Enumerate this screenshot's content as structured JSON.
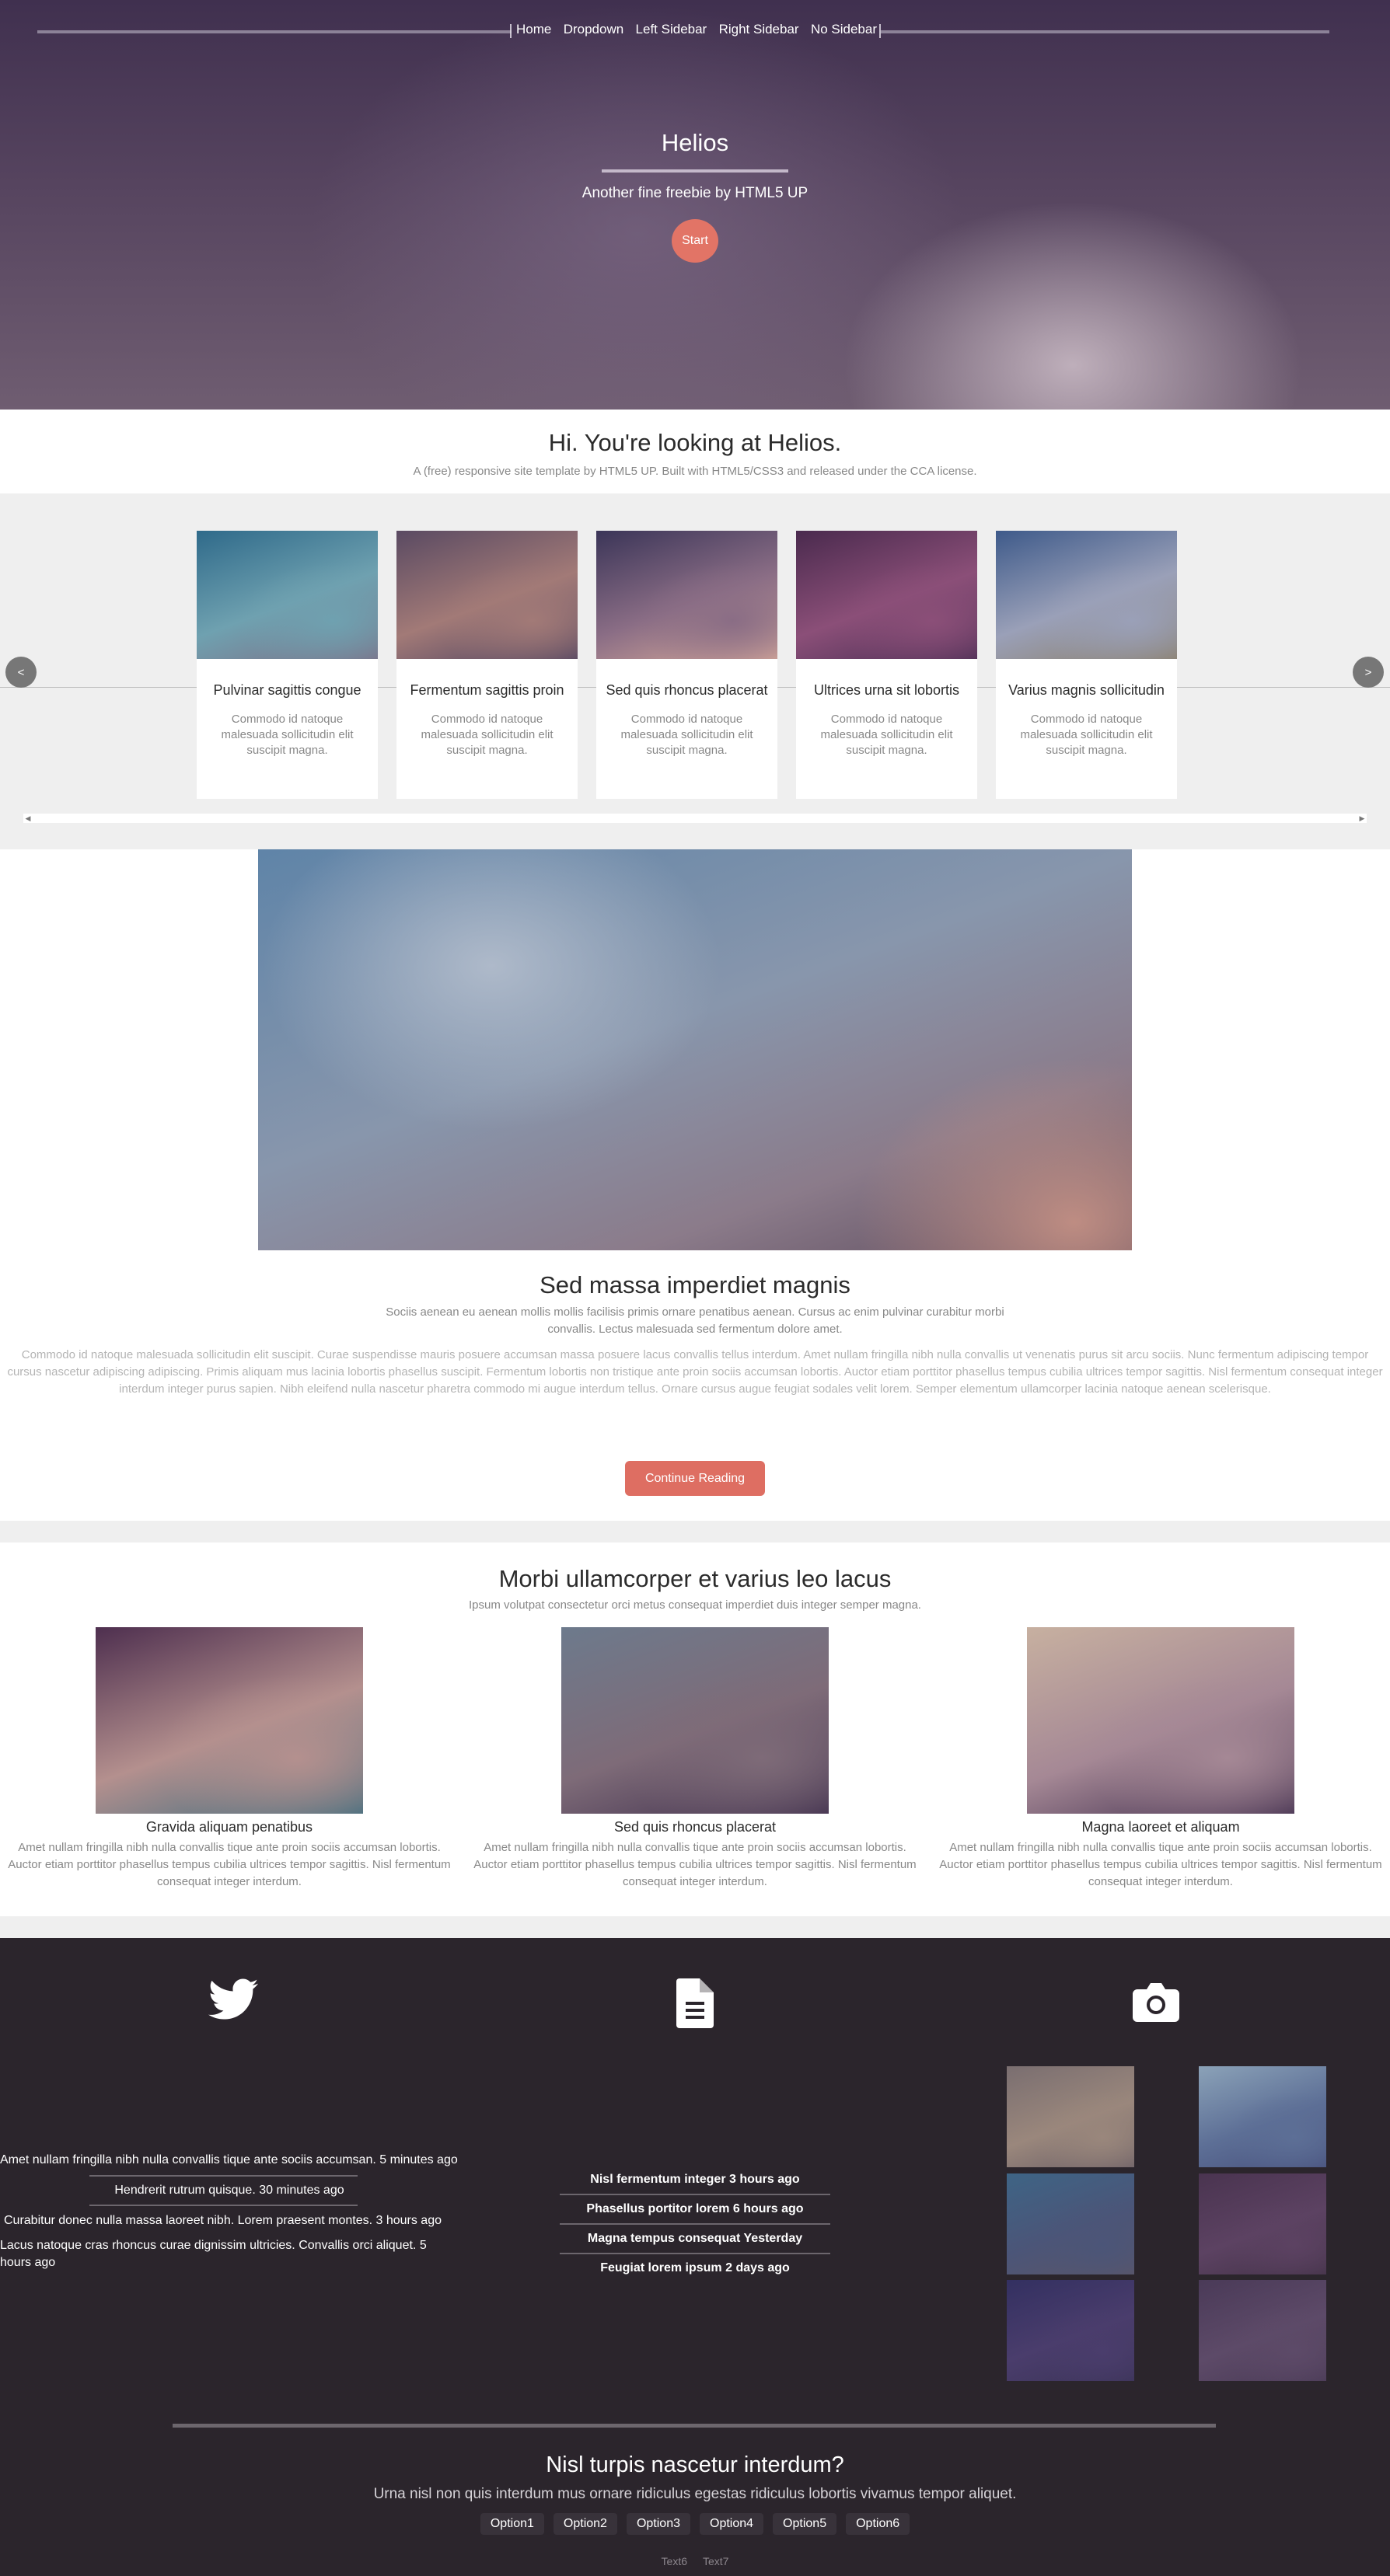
{
  "nav": {
    "items": [
      "Home",
      "Dropdown",
      "Left Sidebar",
      "Right Sidebar",
      "No Sidebar"
    ]
  },
  "hero": {
    "title": "Helios",
    "subtitle": "Another fine freebie by HTML5 UP",
    "button": "Start"
  },
  "intro": {
    "title": "Hi. You're looking at Helios.",
    "subtitle": "A (free) responsive site template by HTML5 UP. Built with HTML5/CSS3 and released under the CCA license."
  },
  "carousel": {
    "prev_icon": "chevron-left-icon",
    "prev_label": "<",
    "next_icon": "chevron-right-icon",
    "next_label": ">",
    "scroll_left": "◀",
    "scroll_right": "▶",
    "cards": [
      {
        "title": "Pulvinar sagittis congue",
        "desc": "Commodo id natoque malesuada sollicitudin elit suscipit magna.",
        "colors": [
          "#2f6a8a",
          "#6fa1b0",
          "#7d6f86"
        ]
      },
      {
        "title": "Fermentum sagittis proin",
        "desc": "Commodo id natoque malesuada sollicitudin elit suscipit magna.",
        "colors": [
          "#5a4a62",
          "#a27a77",
          "#4f4360"
        ]
      },
      {
        "title": "Sed quis rhoncus placerat",
        "desc": "Commodo id natoque malesuada sollicitudin elit suscipit magna.",
        "colors": [
          "#3b3558",
          "#8a6d85",
          "#d6a99a"
        ]
      },
      {
        "title": "Ultrices urna sit lobortis",
        "desc": "Commodo id natoque malesuada sollicitudin elit suscipit magna.",
        "colors": [
          "#4a2a4e",
          "#8b4f78",
          "#4a2e54"
        ]
      },
      {
        "title": "Varius magnis sollicitudin",
        "desc": "Commodo id natoque malesuada sollicitudin elit suscipit magna.",
        "colors": [
          "#3e5a8a",
          "#9aa0b8",
          "#8b7f6a"
        ]
      }
    ]
  },
  "article": {
    "title": "Sed massa imperdiet magnis",
    "lead": "Sociis aenean eu aenean mollis mollis facilisis primis ornare penatibus aenean. Cursus ac enim pulvinar curabitur morbi convallis. Lectus malesuada sed fermentum dolore amet.",
    "body": "Commodo id natoque malesuada sollicitudin elit suscipit. Curae suspendisse mauris posuere accumsan massa posuere lacus convallis tellus interdum. Amet nullam fringilla nibh nulla convallis ut venenatis purus sit arcu sociis. Nunc fermentum adipiscing tempor cursus nascetur adipiscing adipiscing. Primis aliquam mus lacinia lobortis phasellus suscipit. Fermentum lobortis non tristique ante proin sociis accumsan lobortis. Auctor etiam porttitor phasellus tempus cubilia ultrices tempor sagittis. Nisl fermentum consequat integer interdum integer purus sapien. Nibh eleifend nulla nascetur pharetra commodo mi augue interdum tellus. Ornare cursus augue feugiat sodales velit lorem. Semper elementum ullamcorper lacinia natoque aenean scelerisque.",
    "button": "Continue Reading"
  },
  "features": {
    "title": "Morbi ullamcorper et varius leo lacus",
    "subtitle": "Ipsum volutpat consectetur orci metus consequat imperdiet duis integer semper magna.",
    "items": [
      {
        "title": "Gravida aliquam penatibus",
        "desc": "Amet nullam fringilla nibh nulla convallis tique ante proin sociis accumsan lobortis. Auctor etiam porttitor phasellus tempus cubilia ultrices tempor sagittis. Nisl fermentum consequat integer interdum.",
        "colors": [
          "#4e2f4f",
          "#b4908e",
          "#3c6c7e"
        ]
      },
      {
        "title": "Sed quis rhoncus placerat",
        "desc": "Amet nullam fringilla nibh nulla convallis tique ante proin sociis accumsan lobortis. Auctor etiam porttitor phasellus tempus cubilia ultrices tempor sagittis. Nisl fermentum consequat integer interdum.",
        "colors": [
          "#6d7a8c",
          "#7e6b78",
          "#3e2e4c"
        ]
      },
      {
        "title": "Magna laoreet et aliquam",
        "desc": "Amet nullam fringilla nibh nulla convallis tique ante proin sociis accumsan lobortis. Auctor etiam porttitor phasellus tempus cubilia ultrices tempor sagittis. Nisl fermentum consequat integer interdum.",
        "colors": [
          "#c7b0a0",
          "#a58895",
          "#3e2c4c"
        ]
      }
    ]
  },
  "footer": {
    "twitter_icon": "twitter-icon",
    "document_icon": "document-icon",
    "camera_icon": "camera-icon",
    "tweets": [
      "Amet nullam fringilla nibh nulla convallis tique ante sociis accumsan. 5 minutes ago",
      "Hendrerit rutrum quisque. 30 minutes ago",
      "Curabitur donec nulla massa laoreet nibh. Lorem praesent montes. 3 hours ago",
      "Lacus natoque cras rhoncus curae dignissim ultricies. Convallis orci aliquet. 5 hours ago"
    ],
    "posts": [
      "Nisl fermentum integer 3 hours ago",
      "Phasellus portitor lorem 6 hours ago",
      "Magna tempus consequat Yesterday",
      "Feugiat lorem ipsum 2 days ago"
    ],
    "thumbs": [
      {
        "colors": [
          "#7a6e70",
          "#9a877c",
          "#6b5f66"
        ]
      },
      {
        "colors": [
          "#8ba2b8",
          "#5d6f96",
          "#48517d"
        ]
      },
      {
        "colors": [
          "#3e6485",
          "#4b5578",
          "#5a5568"
        ]
      },
      {
        "colors": [
          "#4a3450",
          "#5c4262",
          "#433348"
        ]
      },
      {
        "colors": [
          "#333061",
          "#4a3d6c",
          "#3c3458"
        ]
      },
      {
        "colors": [
          "#4a3a58",
          "#5d4a68",
          "#4a3b56"
        ]
      }
    ],
    "title": "Nisl turpis nascetur interdum?",
    "subtitle": "Urna nisl non quis interdum mus ornare ridiculus egestas ridiculus lobortis vivamus tempor aliquet.",
    "options": [
      "Option1",
      "Option2",
      "Option3",
      "Option4",
      "Option5",
      "Option6"
    ],
    "texts": [
      "Text6",
      "Text7"
    ]
  }
}
